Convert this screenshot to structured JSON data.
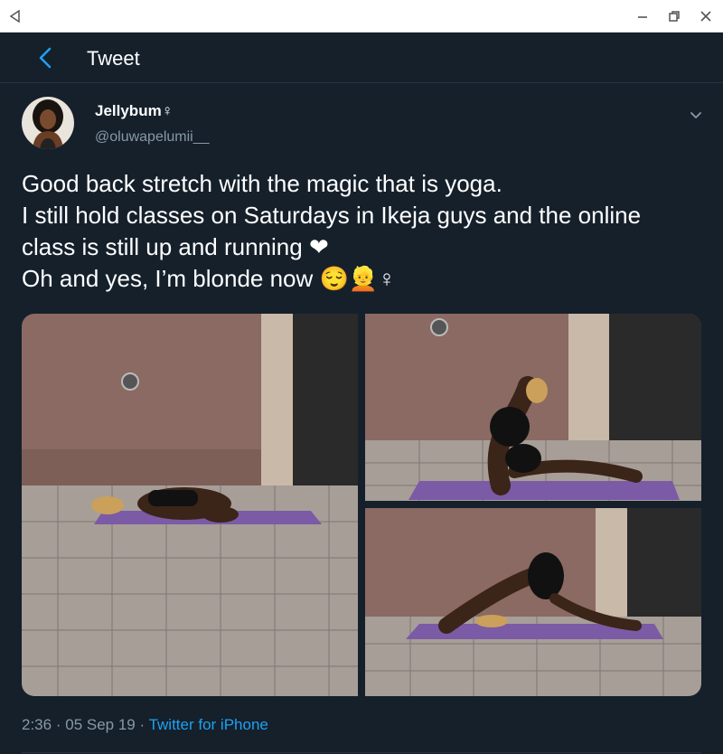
{
  "window": {
    "back_icon": "triangle-left-icon",
    "minimize_icon": "minimize-icon",
    "maximize_icon": "restore-icon",
    "close_icon": "close-icon"
  },
  "header": {
    "back_icon": "chevron-left-icon",
    "title": "Tweet"
  },
  "tweet": {
    "author": {
      "display_name": "Jellybum♀",
      "handle": "@oluwapelumii__"
    },
    "text_lines": [
      "Good back stretch with the magic that is yoga.",
      "I still hold classes on Saturdays in Ikeja guys and the online",
      "class is still up and running ❤",
      "Oh and yes, I’m blonde now 😌👱♀"
    ],
    "media": [
      {
        "alt": "photo-child-pose"
      },
      {
        "alt": "photo-pigeon-pose-backbend"
      },
      {
        "alt": "photo-pigeon-pose-forward"
      }
    ],
    "time": "2:36",
    "date": "05 Sep 19",
    "separator": "·",
    "source": "Twitter for iPhone"
  },
  "colors": {
    "background": "#15202b",
    "accent": "#1da1f2",
    "secondary_text": "#8899a6"
  }
}
